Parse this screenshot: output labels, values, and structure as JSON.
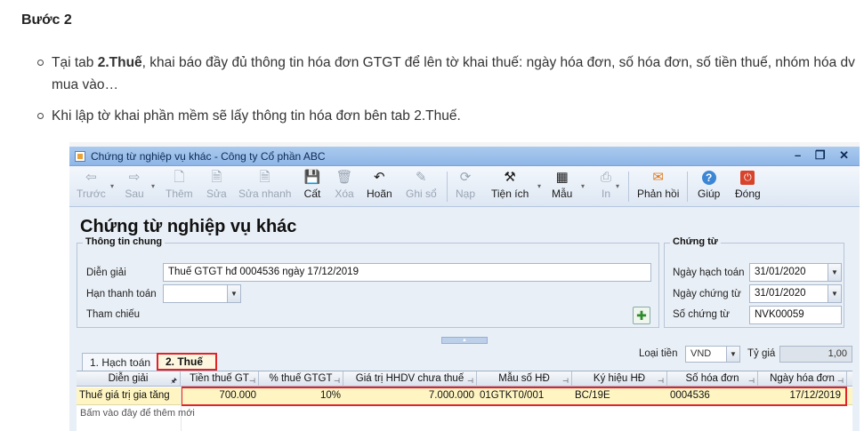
{
  "doc": {
    "heading": "Bước 2",
    "bullet1": {
      "prefix": "Tại tab ",
      "bold": "2.Thuế",
      "rest": ", khai báo đầy đủ thông tin hóa đơn GTGT để lên tờ khai thuế: ngày hóa đơn, số hóa đơn, số tiền thuế, nhóm hóa dv mua vào…"
    },
    "bullet2": "Khi lập tờ khai phần mềm sẽ lấy thông tin hóa đơn bên tab 2.Thuế."
  },
  "window": {
    "title": "Chứng từ nghiệp vụ khác - Công ty Cổ phần ABC",
    "controls": "– ❐ ✕"
  },
  "toolbar": {
    "items": [
      {
        "label": "Trước",
        "icon": "arrow-left-icon",
        "glyph": "⇦",
        "enabled": false
      },
      {
        "label": "Sau",
        "icon": "arrow-right-icon",
        "glyph": "⇨",
        "enabled": false
      },
      {
        "label": "Thêm",
        "icon": "add-document-icon",
        "glyph": "🗋",
        "enabled": false
      },
      {
        "label": "Sửa",
        "icon": "edit-document-icon",
        "glyph": "🗎",
        "enabled": false
      },
      {
        "label": "Sửa nhanh",
        "icon": "quick-edit-icon",
        "glyph": "🗎",
        "enabled": false
      },
      {
        "label": "Cất",
        "icon": "save-icon",
        "glyph": "💾",
        "enabled": true
      },
      {
        "label": "Xóa",
        "icon": "delete-icon",
        "glyph": "🗑",
        "enabled": false
      },
      {
        "label": "Hoãn",
        "icon": "undo-icon",
        "glyph": "↶",
        "enabled": true
      },
      {
        "label": "Ghi sổ",
        "icon": "post-ledger-icon",
        "glyph": "✎",
        "enabled": false
      },
      {
        "label": "Nạp",
        "icon": "reload-icon",
        "glyph": "⟳",
        "enabled": false
      },
      {
        "label": "Tiện ích",
        "icon": "utilities-icon",
        "glyph": "⚒",
        "enabled": true
      },
      {
        "label": "Mẫu",
        "icon": "template-icon",
        "glyph": "▦",
        "enabled": true
      },
      {
        "label": "In",
        "icon": "print-icon",
        "glyph": "⎙",
        "enabled": false
      },
      {
        "label": "Phản hồi",
        "icon": "feedback-mail-icon",
        "glyph": "✉",
        "enabled": true
      },
      {
        "label": "Giúp",
        "icon": "help-icon",
        "glyph": "?",
        "enabled": true
      },
      {
        "label": "Đóng",
        "icon": "close-power-icon",
        "glyph": "⏻",
        "enabled": true
      }
    ]
  },
  "form": {
    "title": "Chứng từ nghiệp vụ khác",
    "general": {
      "legend": "Thông tin chung",
      "description_label": "Diễn giải",
      "description_value": "Thuế GTGT hđ 0004536 ngày 17/12/2019",
      "payment_term_label": "Hạn thanh toán",
      "payment_term_value": "",
      "reference_label": "Tham chiếu"
    },
    "voucher": {
      "legend": "Chứng từ",
      "posting_date_label": "Ngày hạch toán",
      "posting_date_value": "31/01/2020",
      "voucher_date_label": "Ngày chứng từ",
      "voucher_date_value": "31/01/2020",
      "voucher_no_label": "Số chứng từ",
      "voucher_no_value": "NVK00059"
    }
  },
  "tabs": {
    "accounting": "1. Hạch toán",
    "tax": "2. Thuế"
  },
  "currency": {
    "label": "Loại tiền",
    "value": "VND",
    "rate_label": "Tỷ giá",
    "rate_value": "1,00"
  },
  "grid": {
    "columns": [
      "Diễn giải",
      "Tiền thuế GT",
      "% thuế GTGT",
      "Giá trị HHDV chưa thuế",
      "Mẫu số HĐ",
      "Ký hiệu HĐ",
      "Số hóa đơn",
      "Ngày hóa đơn"
    ],
    "row": {
      "description": "Thuế giá trị gia tăng",
      "vat_amount": "700.000",
      "vat_rate": "10%",
      "net_value": "7.000.000",
      "form_no": "01GTKT0/001",
      "symbol": "BC/19E",
      "invoice_no": "0004536",
      "invoice_date": "17/12/2019"
    },
    "add_hint": "Bấm vào đây để thêm mới"
  },
  "colors": {
    "highlight_border": "#e0222b",
    "row_selected": "#fff5c2",
    "titlebar": "#8eb6e6"
  }
}
